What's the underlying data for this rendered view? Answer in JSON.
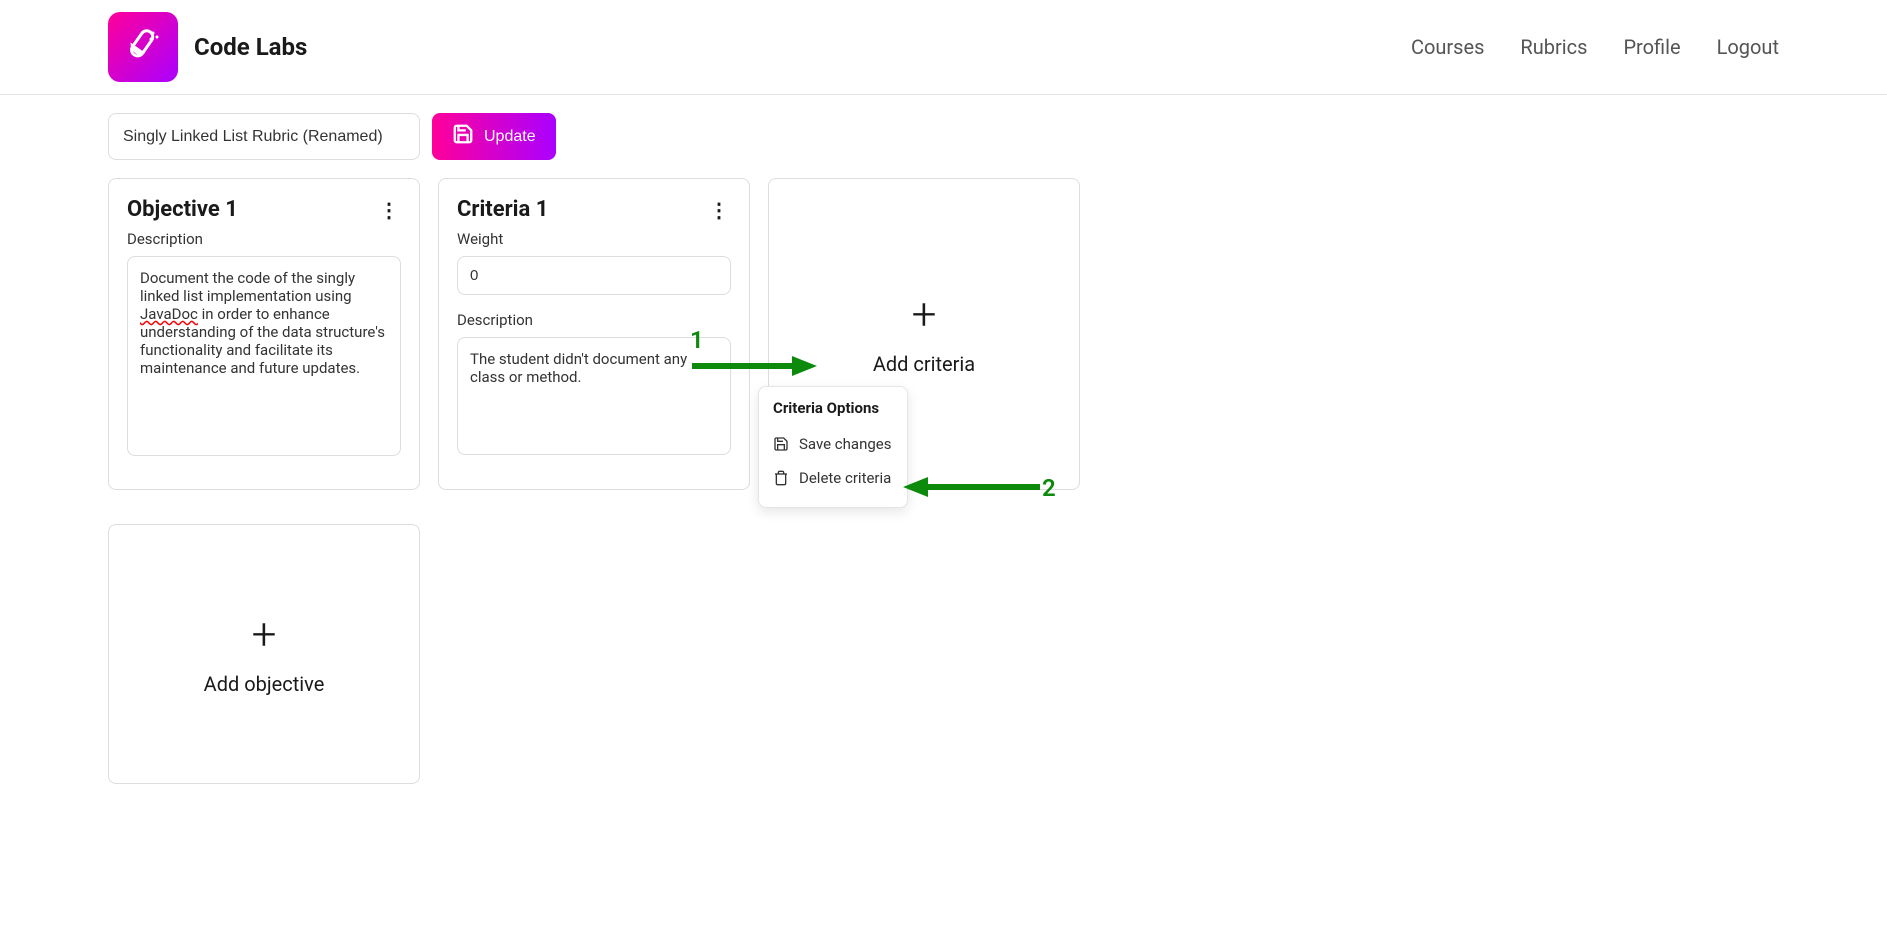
{
  "header": {
    "app_name": "Code Labs",
    "nav": {
      "courses": "Courses",
      "rubrics": "Rubrics",
      "profile": "Profile",
      "logout": "Logout"
    }
  },
  "toolbar": {
    "rubric_name": "Singly Linked List Rubric (Renamed)",
    "update_label": "Update"
  },
  "objective": {
    "title": "Objective 1",
    "description_label": "Description",
    "description_prefix": "Document the code of the singly linked list implementation using ",
    "description_underlined": "JavaDoc",
    "description_suffix": " in order to enhance understanding of the data structure's functionality and facilitate its maintenance and future updates."
  },
  "criteria": {
    "title": "Criteria 1",
    "weight_label": "Weight",
    "weight_value": "0",
    "description_label": "Description",
    "description_value": "The student didn't document any class or method."
  },
  "add_criteria": {
    "label": "Add criteria"
  },
  "add_objective": {
    "label": "Add objective"
  },
  "dropdown": {
    "title": "Criteria Options",
    "save_label": "Save changes",
    "delete_label": "Delete criteria"
  },
  "annotations": {
    "one": "1",
    "two": "2"
  }
}
